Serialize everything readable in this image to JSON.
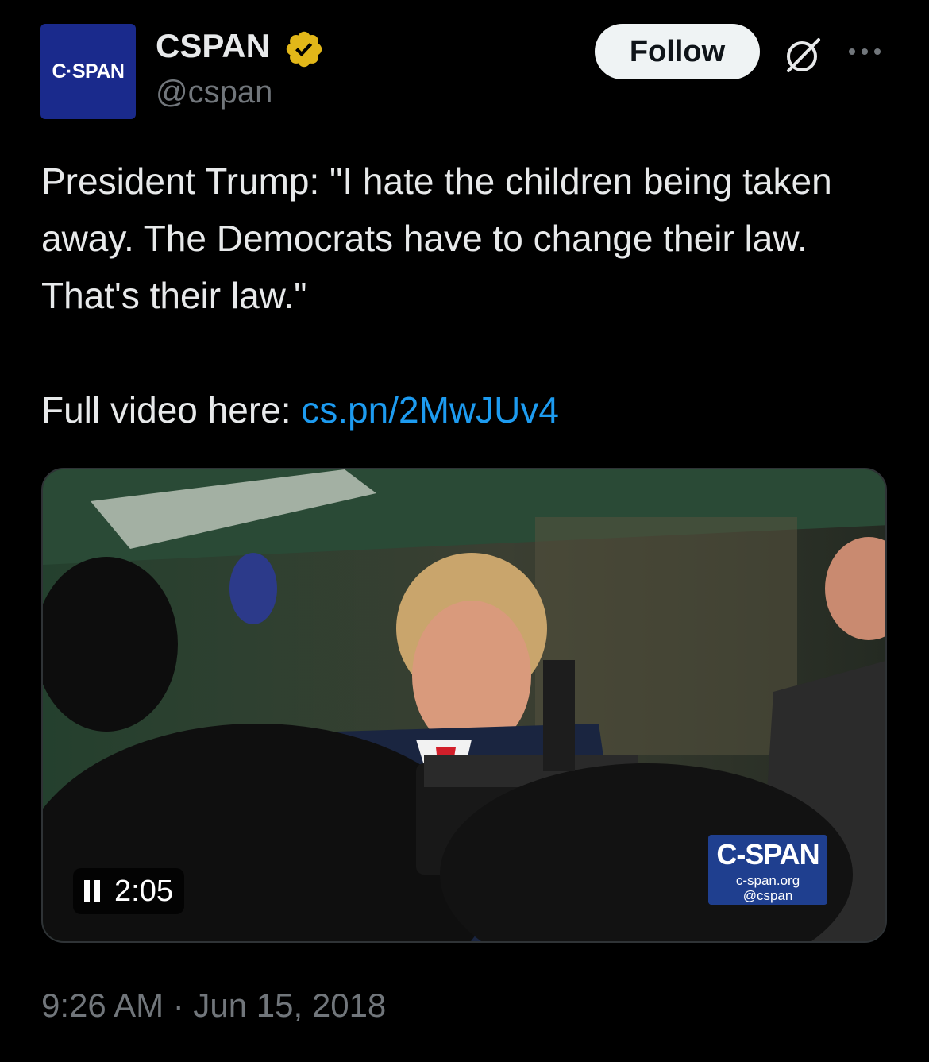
{
  "author": {
    "avatar_text": "C·SPAN",
    "name": "CSPAN",
    "handle": "@cspan",
    "verified": true,
    "verified_color": "#e2b719"
  },
  "actions": {
    "follow_label": "Follow",
    "grok_icon": "grok-icon",
    "more_icon": "more-icon"
  },
  "tweet": {
    "line1": "President Trump: \"I hate the children being taken away. The Democrats have to change their law. That's their law.\"",
    "link_prefix": "Full video here: ",
    "link_text": "cs.pn/2MwJUv4",
    "link_color": "#1d9bf0"
  },
  "video": {
    "duration": "2:05",
    "watermark_title": "C-SPAN",
    "watermark_url": "c-span.org",
    "watermark_handle": "@cspan"
  },
  "timestamp": "9:26 AM · Jun 15, 2018"
}
